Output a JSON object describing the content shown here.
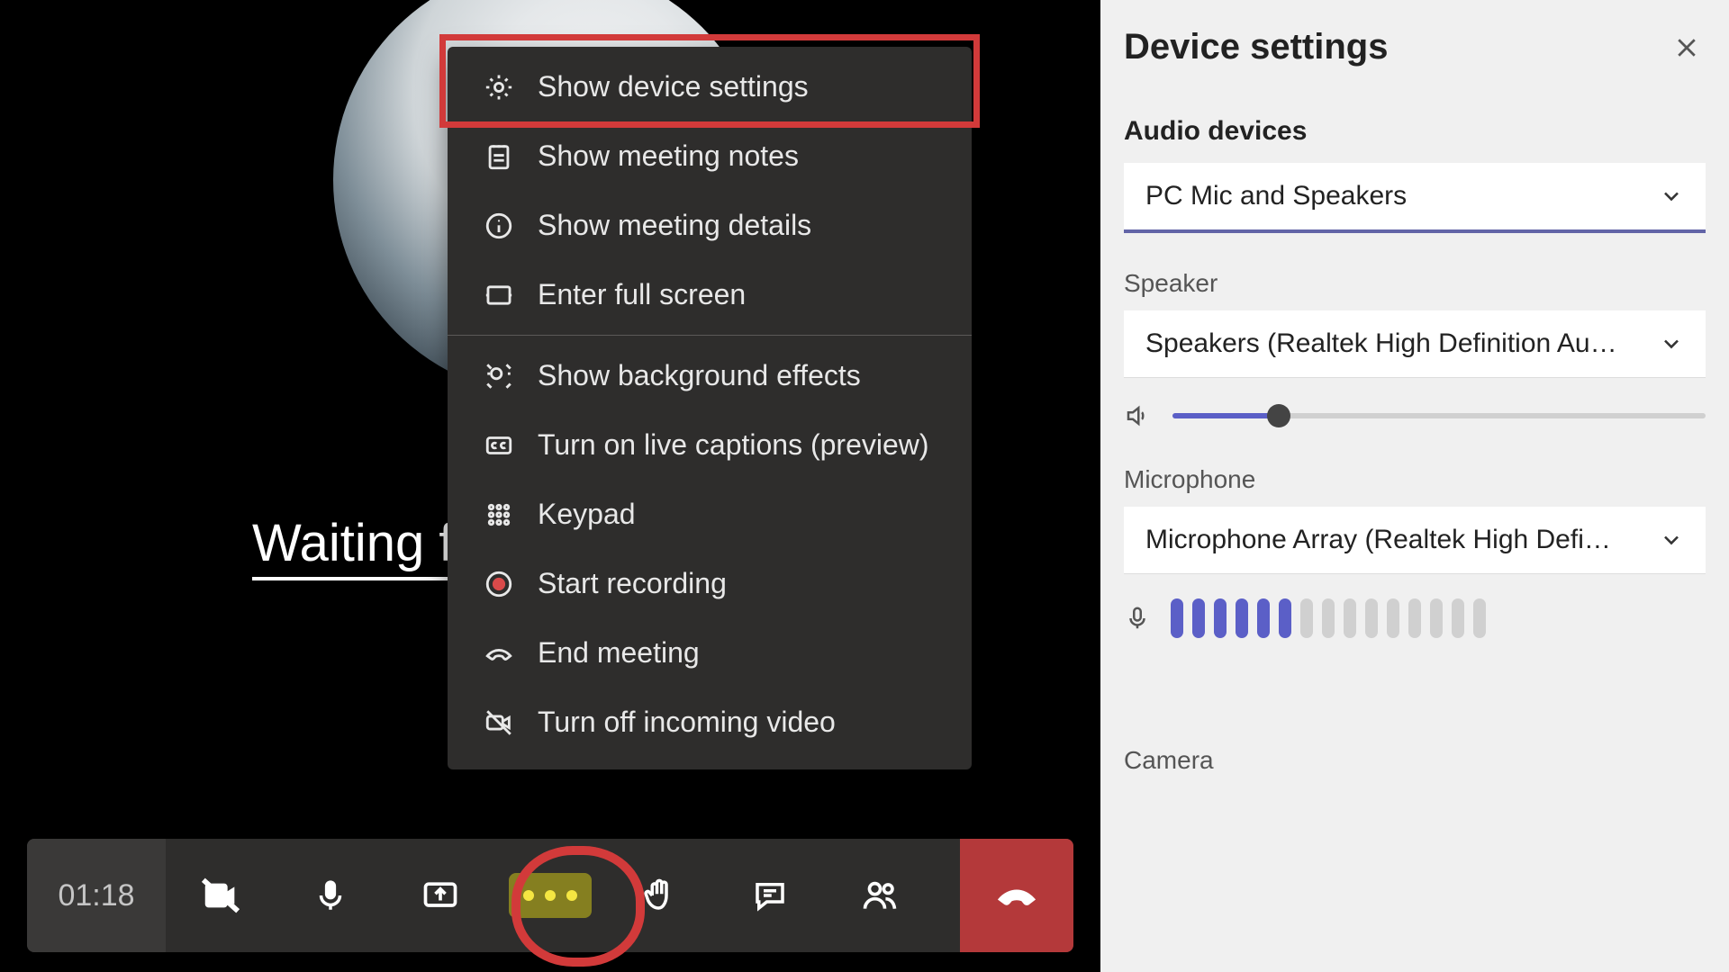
{
  "call": {
    "waiting_text": "Waiting f",
    "timer": "01:18"
  },
  "menu": {
    "items": [
      {
        "label": "Show device settings"
      },
      {
        "label": "Show meeting notes"
      },
      {
        "label": "Show meeting details"
      },
      {
        "label": "Enter full screen"
      },
      {
        "label": "Show background effects"
      },
      {
        "label": "Turn on live captions (preview)"
      },
      {
        "label": "Keypad"
      },
      {
        "label": "Start recording"
      },
      {
        "label": "End meeting"
      },
      {
        "label": "Turn off incoming video"
      }
    ]
  },
  "panel": {
    "title": "Device settings",
    "audio_section": "Audio devices",
    "audio_select": "PC Mic and Speakers",
    "speaker_label": "Speaker",
    "speaker_select": "Speakers (Realtek High Definition Au…",
    "microphone_label": "Microphone",
    "microphone_select": "Microphone Array (Realtek High Defi…",
    "camera_label": "Camera",
    "mic_active_bars": 6,
    "mic_total_bars": 15,
    "volume_percent": 20
  }
}
